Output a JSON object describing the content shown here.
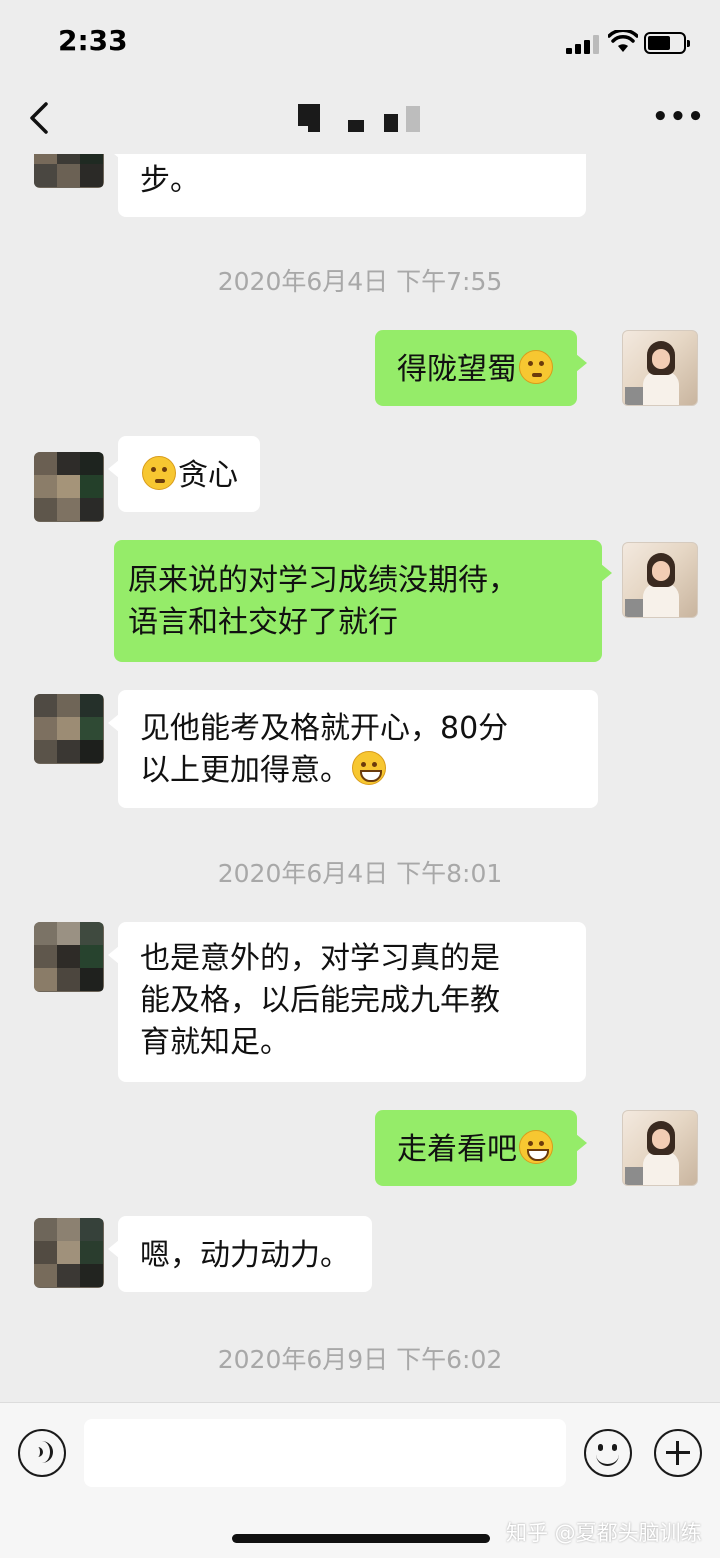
{
  "status_bar": {
    "time": "2:33"
  },
  "header": {
    "back_icon": "chevron-left-icon",
    "more_icon": "ellipsis-icon",
    "more_label": "•••",
    "title_obscured": true
  },
  "messages": [
    {
      "type": "in",
      "text": "步。",
      "partial_top": true
    },
    {
      "type": "timestamp",
      "text": "2020年6月4日 下午7:55"
    },
    {
      "type": "out",
      "text": "得陇望蜀",
      "emoji": "thinking"
    },
    {
      "type": "in",
      "text": "贪心",
      "emoji_before": "thinking"
    },
    {
      "type": "out",
      "text": "原来说的对学习成绩没期待，\n语言和社交好了就行"
    },
    {
      "type": "in",
      "text": "见他能考及格就开心，80分\n以上更加得意。",
      "emoji": "grin"
    },
    {
      "type": "timestamp",
      "text": "2020年6月4日 下午8:01"
    },
    {
      "type": "in",
      "text": "也是意外的，对学习真的是\n能及格，以后能完成九年教\n育就知足。"
    },
    {
      "type": "out",
      "text": "走着看吧",
      "emoji": "grin"
    },
    {
      "type": "in",
      "text": "嗯，动力动力。"
    },
    {
      "type": "timestamp",
      "text": "2020年6月9日 下午6:02"
    }
  ],
  "input_bar": {
    "voice_icon": "voice-icon",
    "emoji_icon": "emoji-icon",
    "plus_icon": "plus-icon",
    "value": ""
  },
  "watermark": "知乎 @夏都头脑训练",
  "colors": {
    "background": "#ededed",
    "bubble_out": "#95ec69",
    "bubble_in": "#ffffff",
    "timestamp": "#a8a8a8"
  }
}
